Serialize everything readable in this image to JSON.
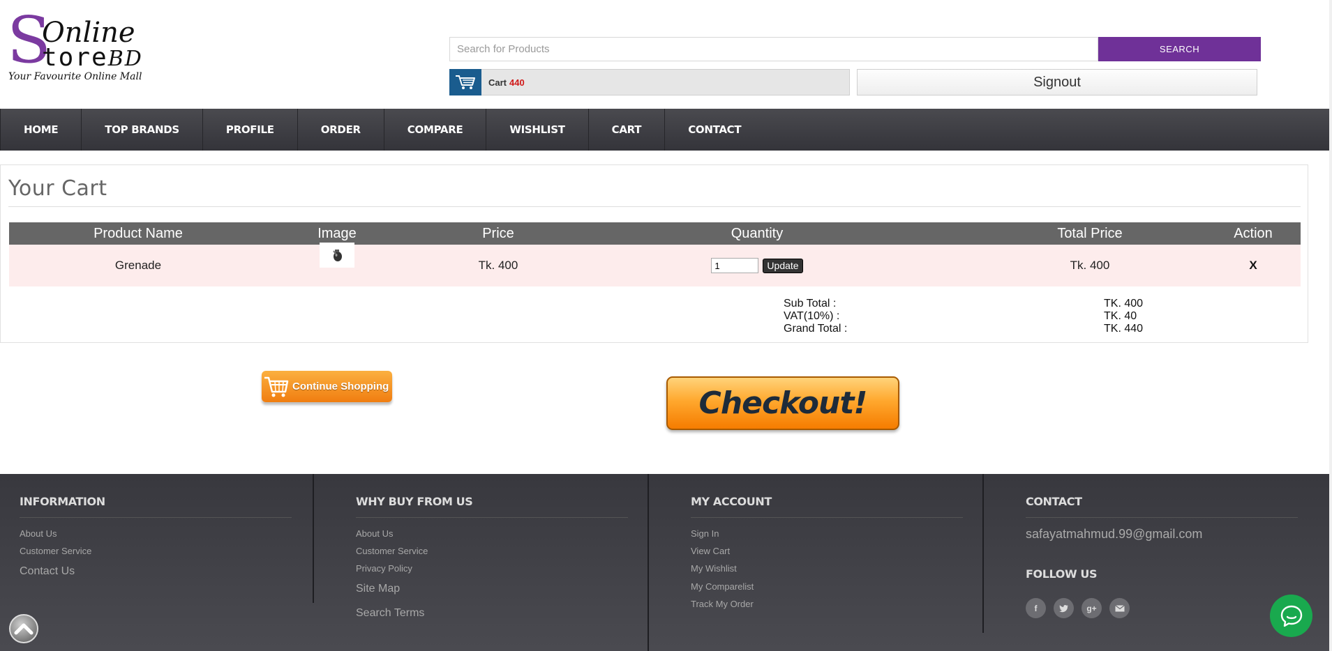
{
  "header": {
    "logo": {
      "big_letter": "S",
      "line1": "Online",
      "line2": "tore",
      "line2_suffix": "BD",
      "tagline": "Your Favourite Online Mall"
    },
    "search": {
      "placeholder": "Search for Products",
      "button_label": "SEARCH"
    },
    "cart": {
      "label": "Cart",
      "amount": "440"
    },
    "signout_label": "Signout"
  },
  "nav": {
    "items": [
      "HOME",
      "TOP BRANDS",
      "PROFILE",
      "ORDER",
      "COMPARE",
      "WISHLIST",
      "CART",
      "CONTACT"
    ]
  },
  "cart_page": {
    "title": "Your Cart",
    "columns": [
      "Product Name",
      "Image",
      "Price",
      "Quantity",
      "Total Price",
      "Action"
    ],
    "rows": [
      {
        "product_name": "Grenade",
        "price": "Tk. 400",
        "quantity": "1",
        "update_label": "Update",
        "total_price": "Tk. 400",
        "action": "X"
      }
    ],
    "totals": {
      "labels": [
        "Sub Total :",
        "VAT(10%) :",
        "Grand Total :"
      ],
      "values": [
        "TK. 400",
        "TK. 40",
        "TK. 440"
      ]
    },
    "continue_label": "Continue Shopping",
    "checkout_label": "Checkout!"
  },
  "footer": {
    "information": {
      "title": "INFORMATION",
      "links": [
        "About Us",
        "Customer Service",
        "Contact Us"
      ]
    },
    "why_buy": {
      "title": "WHY BUY FROM US",
      "links": [
        "About Us",
        "Customer Service",
        "Privacy Policy",
        "Site Map",
        "Search Terms"
      ]
    },
    "my_account": {
      "title": "MY ACCOUNT",
      "links": [
        "Sign In",
        "View Cart",
        "My Wishlist",
        "My Comparelist",
        "Track My Order"
      ]
    },
    "contact": {
      "title": "CONTACT",
      "email": "safayatmahmud.99@gmail.com",
      "follow_title": "FOLLOW US",
      "social_icons": [
        "facebook-icon",
        "twitter-icon",
        "google-plus-icon",
        "mail-icon"
      ]
    }
  },
  "colors": {
    "brand_purple": "#6f3198",
    "nav_bg": "#3e3e44",
    "cart_icon_bg": "#1a5c8e",
    "cart_count": "#d01818",
    "chat_green": "#19a94e"
  }
}
